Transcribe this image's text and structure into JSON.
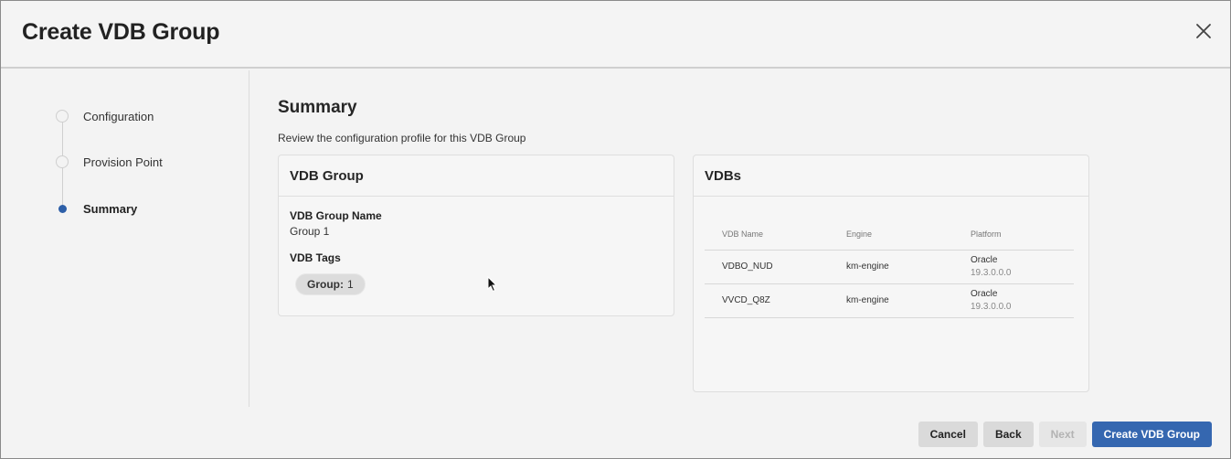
{
  "dialog": {
    "title": "Create VDB Group"
  },
  "stepper": {
    "steps": [
      {
        "label": "Configuration",
        "state": "done"
      },
      {
        "label": "Provision Point",
        "state": "done"
      },
      {
        "label": "Summary",
        "state": "active"
      }
    ]
  },
  "summary": {
    "title": "Summary",
    "subtitle": "Review the configuration profile for this VDB Group"
  },
  "vdb_group_card": {
    "header": "VDB Group",
    "name_label": "VDB Group Name",
    "name_value": "Group 1",
    "tags_label": "VDB Tags",
    "tag": {
      "key": "Group:",
      "value": "1"
    }
  },
  "vdbs_card": {
    "header": "VDBs",
    "columns": [
      "VDB Name",
      "Engine",
      "Platform"
    ],
    "rows": [
      {
        "name": "VDBO_NUD",
        "engine": "km-engine",
        "platform": "Oracle",
        "version": "19.3.0.0.0"
      },
      {
        "name": "VVCD_Q8Z",
        "engine": "km-engine",
        "platform": "Oracle",
        "version": "19.3.0.0.0"
      }
    ]
  },
  "footer": {
    "cancel": "Cancel",
    "back": "Back",
    "next": "Next",
    "create": "Create VDB Group"
  },
  "colors": {
    "accent": "#3567b0",
    "active_step": "#2d5fa8"
  },
  "icons": {
    "close": "close-icon",
    "cursor": "mouse-cursor-icon"
  }
}
